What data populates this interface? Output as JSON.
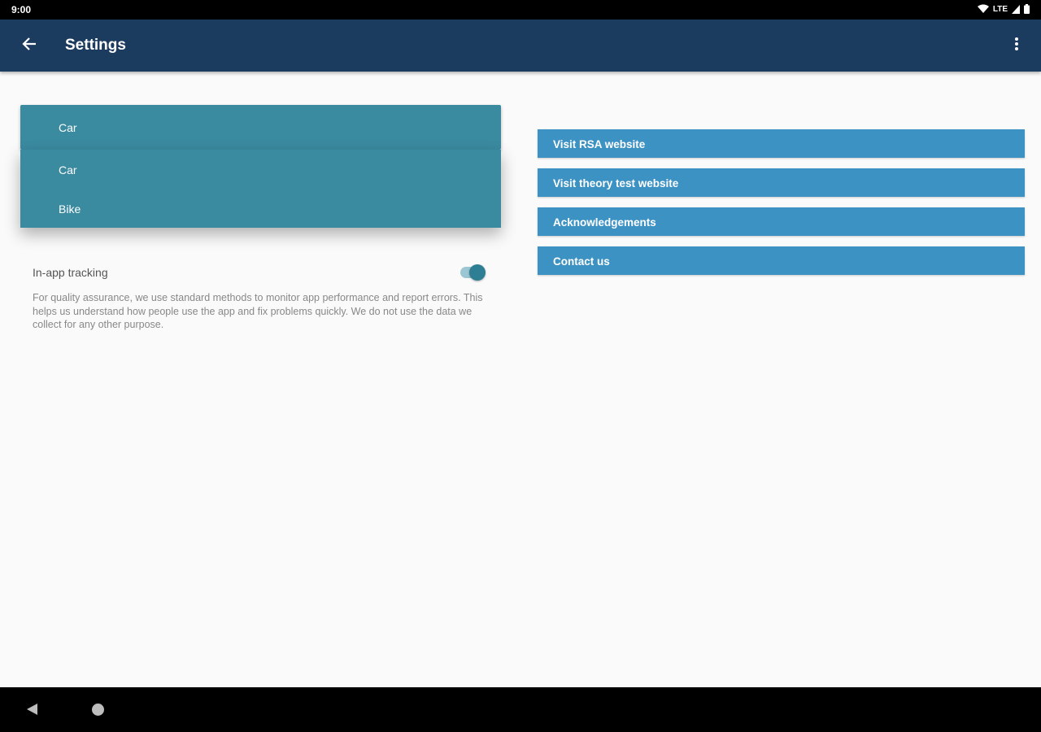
{
  "status_bar": {
    "time": "9:00",
    "network": "LTE"
  },
  "app_bar": {
    "title": "Settings"
  },
  "vehicle_spinner": {
    "selected": "Car",
    "options": [
      "Car",
      "Bike"
    ]
  },
  "tracking": {
    "label": "In-app tracking",
    "enabled": true,
    "description": "For quality assurance, we use standard methods to monitor app performance and report errors. This helps us understand how people use the app and fix problems quickly. We do not use the data we collect for any other purpose."
  },
  "links": [
    {
      "label": "Visit RSA website"
    },
    {
      "label": "Visit theory test website"
    },
    {
      "label": "Acknowledgements"
    },
    {
      "label": "Contact us"
    }
  ],
  "colors": {
    "app_bar": "#1c3c5f",
    "spinner": "#3a8aa0",
    "link_button": "#3d92c4",
    "toggle_thumb": "#2e7e94"
  },
  "icons": {
    "back": "arrow-left-icon",
    "overflow": "more-vert-icon",
    "wifi": "wifi-icon",
    "signal": "signal-icon",
    "battery": "battery-icon",
    "nav_back": "nav-back-icon",
    "nav_home": "nav-home-icon"
  }
}
